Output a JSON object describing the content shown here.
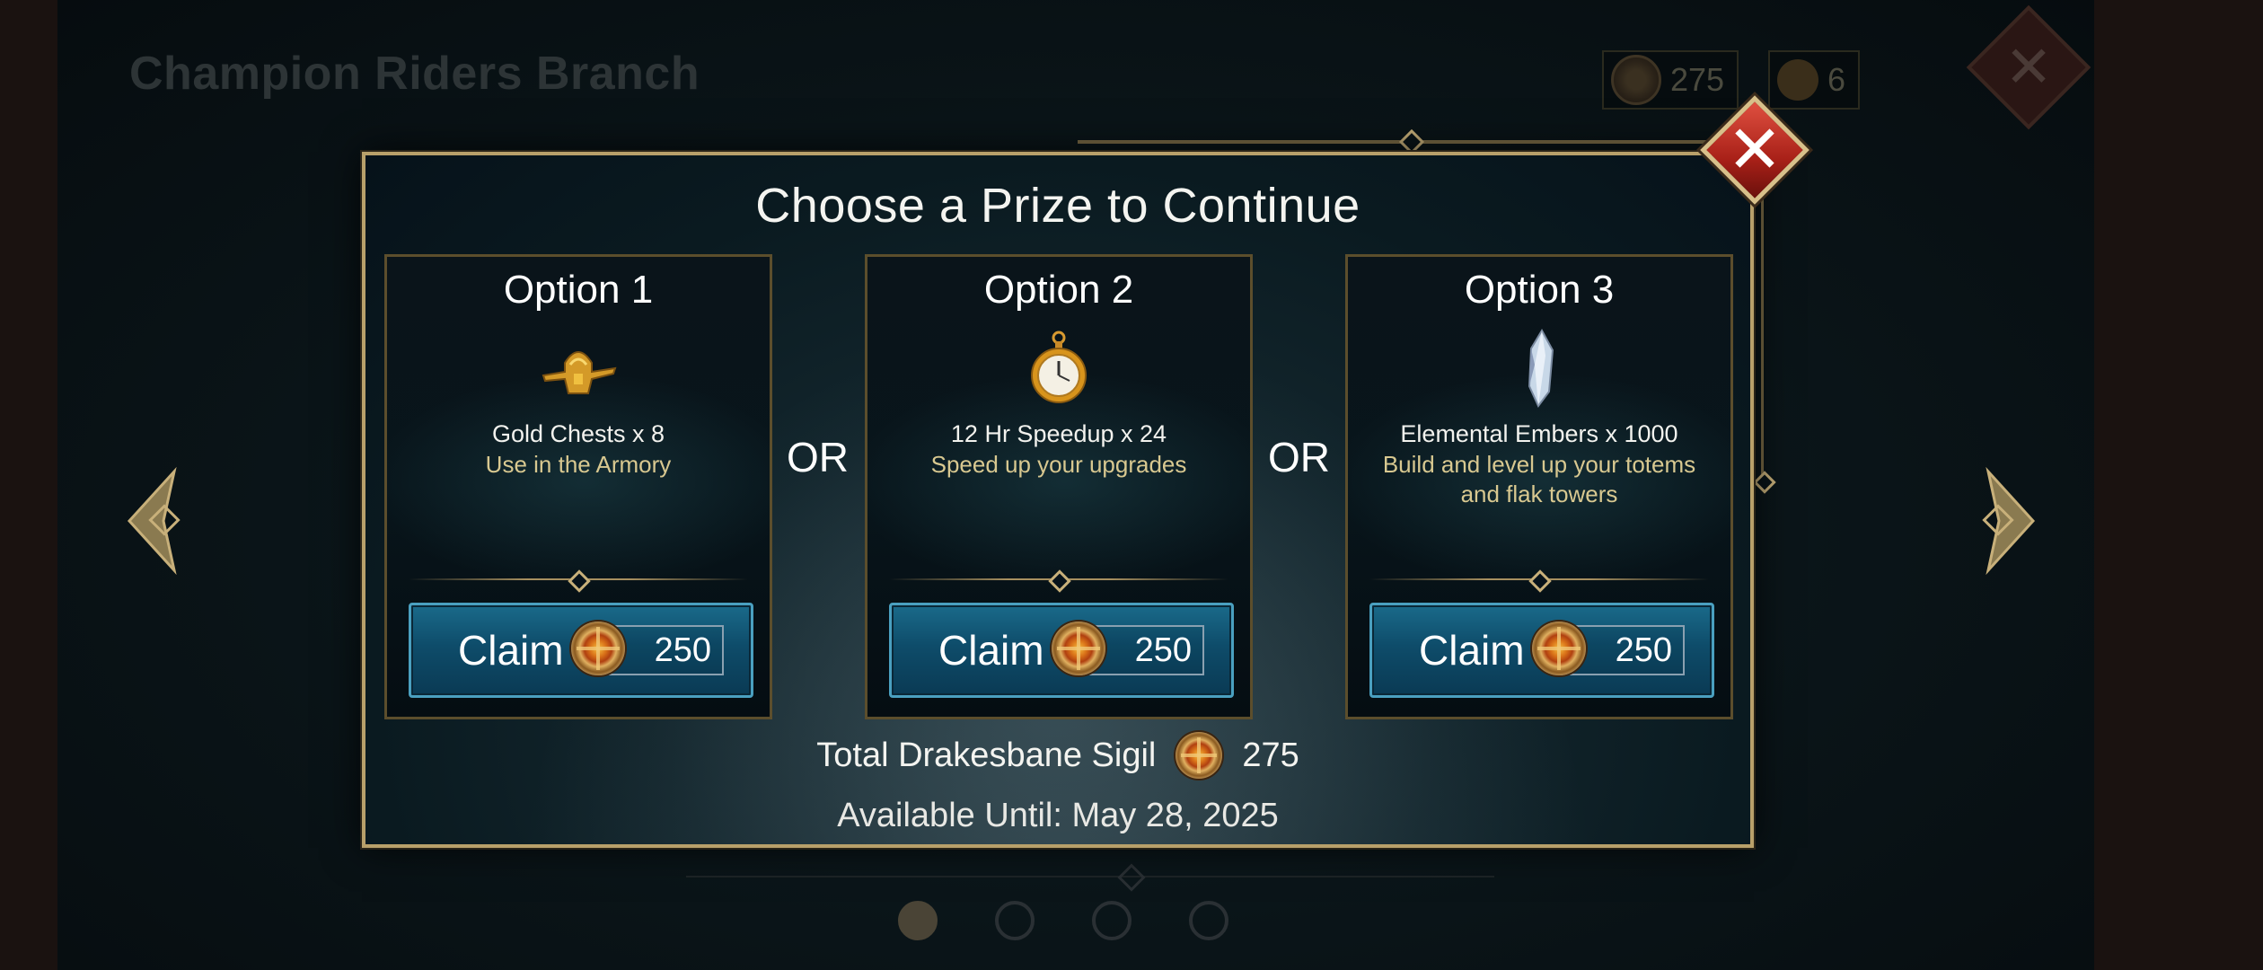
{
  "background": {
    "title": "Champion Riders Branch",
    "currency_sigil": "275",
    "currency_tokens": "6"
  },
  "modal": {
    "title": "Choose a Prize to Continue",
    "or_label": "OR",
    "options": [
      {
        "title": "Option 1",
        "item": "Gold Chests x 8",
        "description": "Use in the Armory",
        "icon": "gold-chest-icon",
        "claim_label": "Claim",
        "cost": "250"
      },
      {
        "title": "Option 2",
        "item": "12 Hr Speedup x 24",
        "description": "Speed up your upgrades",
        "icon": "pocket-watch-icon",
        "claim_label": "Claim",
        "cost": "250"
      },
      {
        "title": "Option 3",
        "item": "Elemental Embers x 1000",
        "description": "Build and level up your totems and flak towers",
        "icon": "crystal-ember-icon",
        "claim_label": "Claim",
        "cost": "250"
      }
    ],
    "total_label": "Total Drakesbane Sigil",
    "total_value": "275",
    "available_until": "Available Until: May 28, 2025"
  },
  "pagination": {
    "pages": 4,
    "active": 1
  },
  "colors": {
    "accent_gold": "#b8a06a",
    "button_blue": "#0e4c6a",
    "close_red": "#c0302a",
    "desc_gold": "#d8c890"
  }
}
